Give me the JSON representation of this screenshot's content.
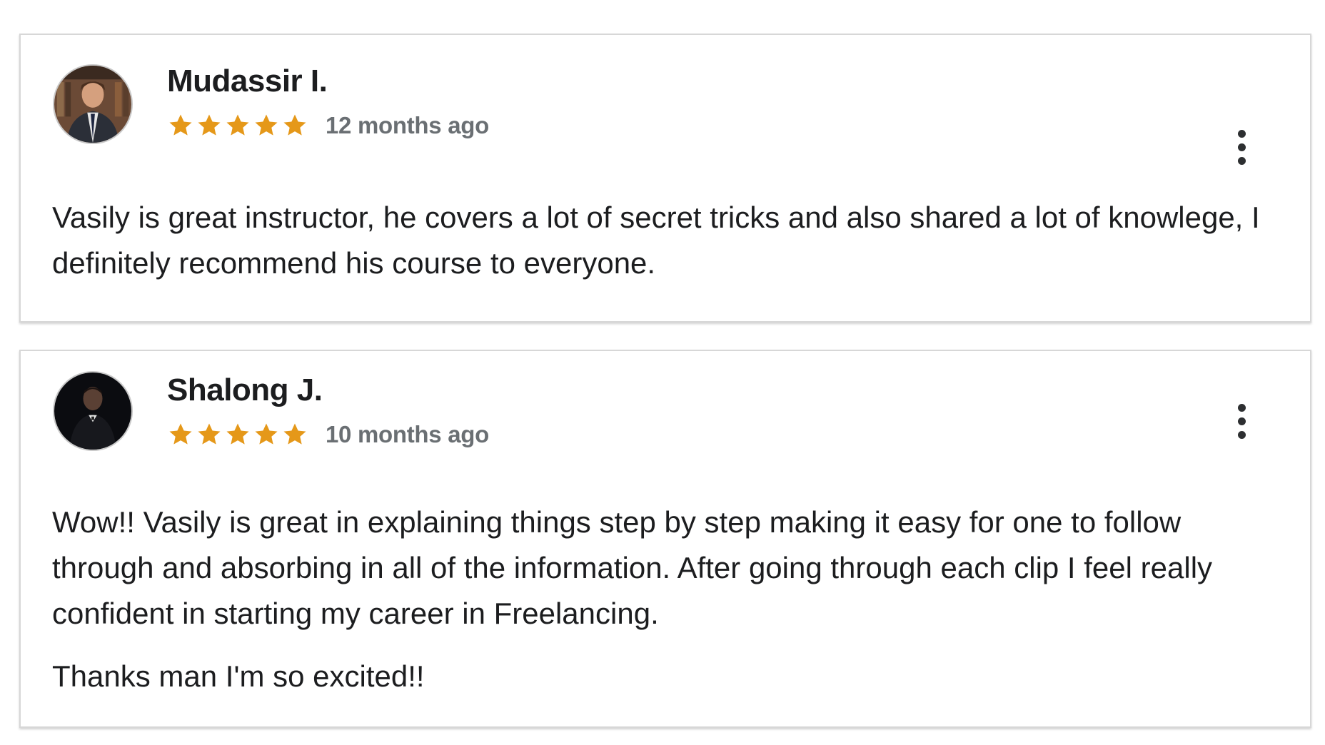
{
  "reviews": [
    {
      "reviewer_name": "Mudassir I.",
      "rating": 5,
      "rating_max": 5,
      "time_ago": "12 months ago",
      "paragraphs": [
        "Vasily is great instructor, he covers a lot of secret tricks and also shared a lot of knowlege, I definitely recommend his course to everyone."
      ]
    },
    {
      "reviewer_name": "Shalong J.",
      "rating": 5,
      "rating_max": 5,
      "time_ago": "10 months ago",
      "paragraphs": [
        "Wow!! Vasily is great in explaining things step by step making it easy for one to follow through and absorbing in all of the information. After going through each clip I feel really confident in starting my career in Freelancing.",
        "Thanks man I'm so excited!!"
      ]
    }
  ],
  "icons": {
    "star": "star-icon",
    "more": "more-options-icon"
  },
  "colors": {
    "star": "#e59819",
    "name_text": "#1c1d1f",
    "meta_text": "#6a6f73",
    "card_border": "#d7d7d7",
    "menu_dots": "#2d2f31"
  }
}
